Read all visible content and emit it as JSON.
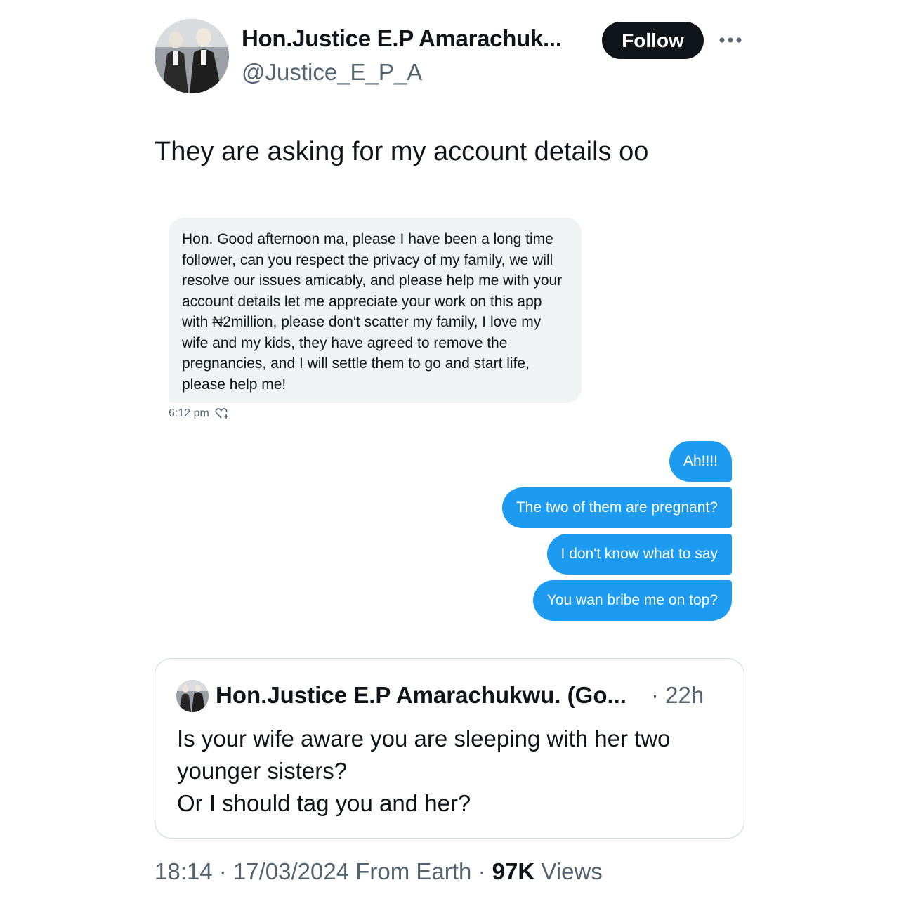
{
  "author": {
    "display_name": "Hon.Justice E.P Amarachuk...",
    "handle": "@Justice_E_P_A"
  },
  "follow_label": "Follow",
  "tweet_text": "They are asking for my account details oo",
  "screenshot": {
    "received_message": "Hon. Good afternoon ma, please I have been a long time follower, can you respect the privacy of my family, we will resolve our issues amicably, and please help me with your account details let me appreciate your work on this app with ₦2million, please don't scatter my family, I love my wife and my kids, they have agreed to remove the pregnancies, and I will settle them to go and start life, please help me!",
    "received_time": "6:12 pm",
    "sent_messages": [
      "Ah!!!!",
      "The two of them are pregnant?",
      "I don't know what to say",
      "You wan bribe me on top?"
    ]
  },
  "quoted_tweet": {
    "display_name": "Hon.Justice E.P Amarachukwu. (Go...",
    "time": "· 22h",
    "text_lines": [
      "Is your wife aware you are sleeping with her two",
      "younger sisters?",
      "Or I should tag you and her?"
    ]
  },
  "footer": {
    "time": "18:14",
    "date": "17/03/2024",
    "source": "From Earth",
    "views_count": "97K",
    "views_label": "Views"
  },
  "colors": {
    "accent_blue": "#1d9bf0",
    "text_primary": "#0f1419",
    "text_secondary": "#536471",
    "bubble_gray": "#eff3f4",
    "border": "#cfd9de"
  }
}
